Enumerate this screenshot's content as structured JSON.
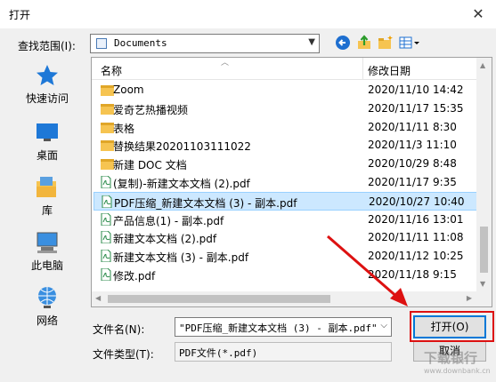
{
  "window": {
    "title": "打开",
    "close_glyph": "✕"
  },
  "toolbar": {
    "look_in_label": "查找范围(I):",
    "look_in_value": "Documents",
    "back_icon": "back-arrow-icon",
    "up_icon": "up-folder-icon",
    "new_folder_icon": "new-folder-icon",
    "view_icon": "view-menu-icon"
  },
  "places": [
    {
      "label": "快速访问",
      "icon": "star-icon"
    },
    {
      "label": "桌面",
      "icon": "desktop-icon"
    },
    {
      "label": "库",
      "icon": "library-icon"
    },
    {
      "label": "此电脑",
      "icon": "computer-icon"
    },
    {
      "label": "网络",
      "icon": "network-icon"
    }
  ],
  "file_list": {
    "columns": {
      "name": "名称",
      "date": "修改日期"
    },
    "rows": [
      {
        "name": "Zoom",
        "date": "2020/11/10 14:42",
        "type": "folder"
      },
      {
        "name": "爱奇艺热播视频",
        "date": "2020/11/17 15:35",
        "type": "folder"
      },
      {
        "name": "表格",
        "date": "2020/11/11 8:30",
        "type": "folder"
      },
      {
        "name": "替换结果20201103111022",
        "date": "2020/11/3 11:10",
        "type": "folder"
      },
      {
        "name": "新建 DOC 文档",
        "date": "2020/10/29 8:48",
        "type": "folder"
      },
      {
        "name": "(复制)-新建文本文档 (2).pdf",
        "date": "2020/11/17 9:35",
        "type": "pdf"
      },
      {
        "name": "PDF压缩_新建文本文档 (3) - 副本.pdf",
        "date": "2020/10/27 10:40",
        "type": "pdf",
        "selected": true
      },
      {
        "name": "产品信息(1) - 副本.pdf",
        "date": "2020/11/16 13:01",
        "type": "pdf"
      },
      {
        "name": "新建文本文档 (2).pdf",
        "date": "2020/11/11 11:08",
        "type": "pdf"
      },
      {
        "name": "新建文本文档 (3) - 副本.pdf",
        "date": "2020/11/12 10:25",
        "type": "pdf"
      },
      {
        "name": "修改.pdf",
        "date": "2020/11/18 9:15",
        "type": "pdf"
      }
    ]
  },
  "filename": {
    "label": "文件名(N):",
    "value": "\"PDF压缩_新建文本文档 (3) - 副本.pdf\""
  },
  "filetype": {
    "label": "文件类型(T):",
    "value": "PDF文件(*.pdf)"
  },
  "buttons": {
    "open": "打开(O)",
    "cancel": "取消"
  },
  "watermark": {
    "main": "下载银行",
    "sub": "www.downbank.cn"
  },
  "colors": {
    "accent": "#0078d7",
    "selection": "#cce8ff",
    "annotation": "#dd1111",
    "folder": "#f6c451"
  }
}
